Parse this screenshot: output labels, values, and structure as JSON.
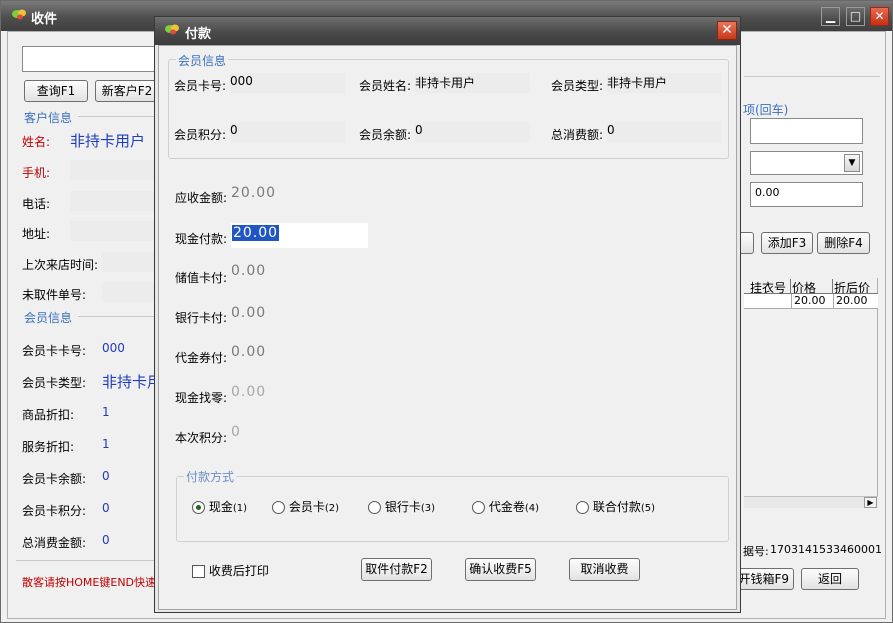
{
  "main": {
    "title": "收件",
    "controls": {
      "minimize": "▁",
      "maximize": "□",
      "close": "✕"
    },
    "buttons": {
      "query": "查询F1",
      "new_customer": "新客户F2"
    },
    "customer_group": "客户信息",
    "customer": {
      "name_label": "姓名:",
      "name_value": "非持卡用户",
      "phone_label": "手机:",
      "tel_label": "电话:",
      "address_label": "地址:",
      "last_visit_label": "上次来店时间:",
      "pending_order_label": "未取件单号:"
    },
    "member_group": "会员信息",
    "member": {
      "card_no_label": "会员卡卡号:",
      "card_no_value": "000",
      "card_type_label": "会员卡类型:",
      "card_type_value": "非持卡用",
      "goods_discount_label": "商品折扣:",
      "goods_discount_value": "1",
      "service_discount_label": "服务折扣:",
      "service_discount_value": "1",
      "balance_label": "会员卡余额:",
      "balance_value": "0",
      "points_label": "会员卡积分:",
      "points_value": "0",
      "total_spent_label": "总消费金额:",
      "total_spent_value": "0"
    },
    "hint": "散客请按HOME键END快速收",
    "right": {
      "item_group": "项(回车)",
      "amount_value": "0.00",
      "add_button": "添加F3",
      "delete_button": "删除F4",
      "table_headers": [
        "挂衣号",
        "价格",
        "折后价"
      ],
      "table_row": {
        "hanger": "",
        "price": "20.00",
        "discounted": "20.00"
      },
      "scroll_right": "▶",
      "receipt_label": "据号:",
      "receipt_no": "1703141533460001",
      "cashbox_button": "开钱箱F9",
      "back_button": "返回"
    }
  },
  "dialog": {
    "title": "付款",
    "close": "✕",
    "member_group": "会员信息",
    "member": {
      "card_no_label": "会员卡号:",
      "card_no_value": "000",
      "name_label": "会员姓名:",
      "name_value": "非持卡用户",
      "type_label": "会员类型:",
      "type_value": "非持卡用户",
      "points_label": "会员积分:",
      "points_value": "0",
      "balance_label": "会员余额:",
      "balance_value": "0",
      "total_label": "总消费额:",
      "total_value": "0"
    },
    "payment": {
      "receivable_label": "应收金额:",
      "receivable_value": "20.00",
      "cash_label": "现金付款:",
      "cash_value": "20.00",
      "stored_card_label": "储值卡付:",
      "stored_card_value": "0.00",
      "bank_card_label": "银行卡付:",
      "bank_card_value": "0.00",
      "voucher_label": "代金券付:",
      "voucher_value": "0.00",
      "change_label": "现金找零:",
      "change_value": "0.00",
      "points_label": "本次积分:",
      "points_value": "0"
    },
    "method_group": "付款方式",
    "methods": [
      {
        "label": "现金",
        "key": "(1)"
      },
      {
        "label": "会员卡",
        "key": "(2)"
      },
      {
        "label": "银行卡",
        "key": "(3)"
      },
      {
        "label": "代金卷",
        "key": "(4)"
      },
      {
        "label": "联合付款",
        "key": "(5)"
      }
    ],
    "selected_method_index": 0,
    "print_after_label": "收费后打印",
    "buttons": {
      "pickup_pay": "取件付款F2",
      "confirm": "确认收费F5",
      "cancel": "取消收费"
    }
  }
}
